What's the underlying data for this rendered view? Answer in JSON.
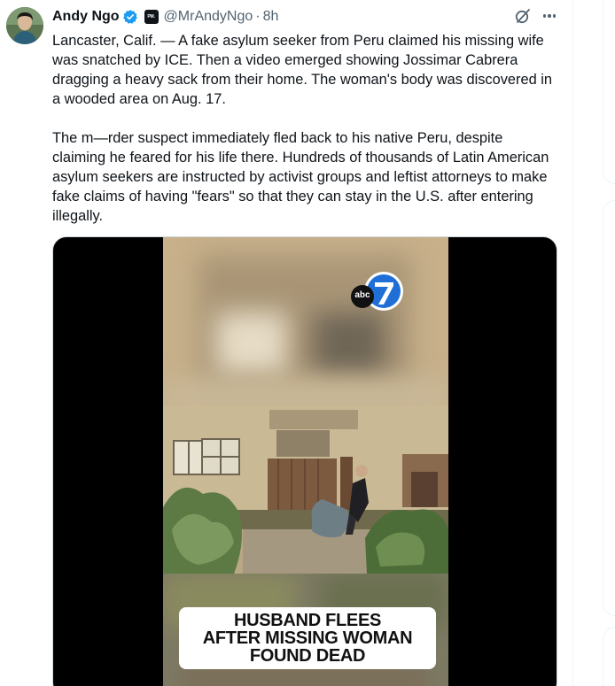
{
  "tweet": {
    "display_name": "Andy Ngo",
    "affiliate_badge": "PM.",
    "handle": "@MrAndyNgo",
    "separator": "·",
    "timestamp": "8h",
    "paragraphs": [
      "Lancaster, Calif. — A fake asylum seeker from Peru claimed his missing wife was snatched by ICE. Then a video emerged showing Jossimar Cabrera dragging a heavy sack from their home. The woman's body was discovered in a wooded area on Aug. 17.",
      "The m—rder suspect immediately fled back to his native Peru, despite claiming he feared for his life there. Hundreds of thousands of Latin American asylum seekers are instructed by activist groups and leftist attorneys to make fake claims of having \"fears\" so that they can stay in the U.S. after entering illegally."
    ]
  },
  "media": {
    "logo_text": "abc",
    "logo_number": "7",
    "caption_lines": [
      "HUSBAND FLEES",
      "AFTER MISSING WOMAN",
      "FOUND DEAD"
    ]
  },
  "icons": {
    "verified": "verified-check-icon",
    "grok": "grok-icon",
    "more": "more-options-icon"
  },
  "colors": {
    "text_primary": "#0f1419",
    "text_secondary": "#536471",
    "verified_blue": "#1d9bf0",
    "abc_blue": "#1f6fd6"
  }
}
